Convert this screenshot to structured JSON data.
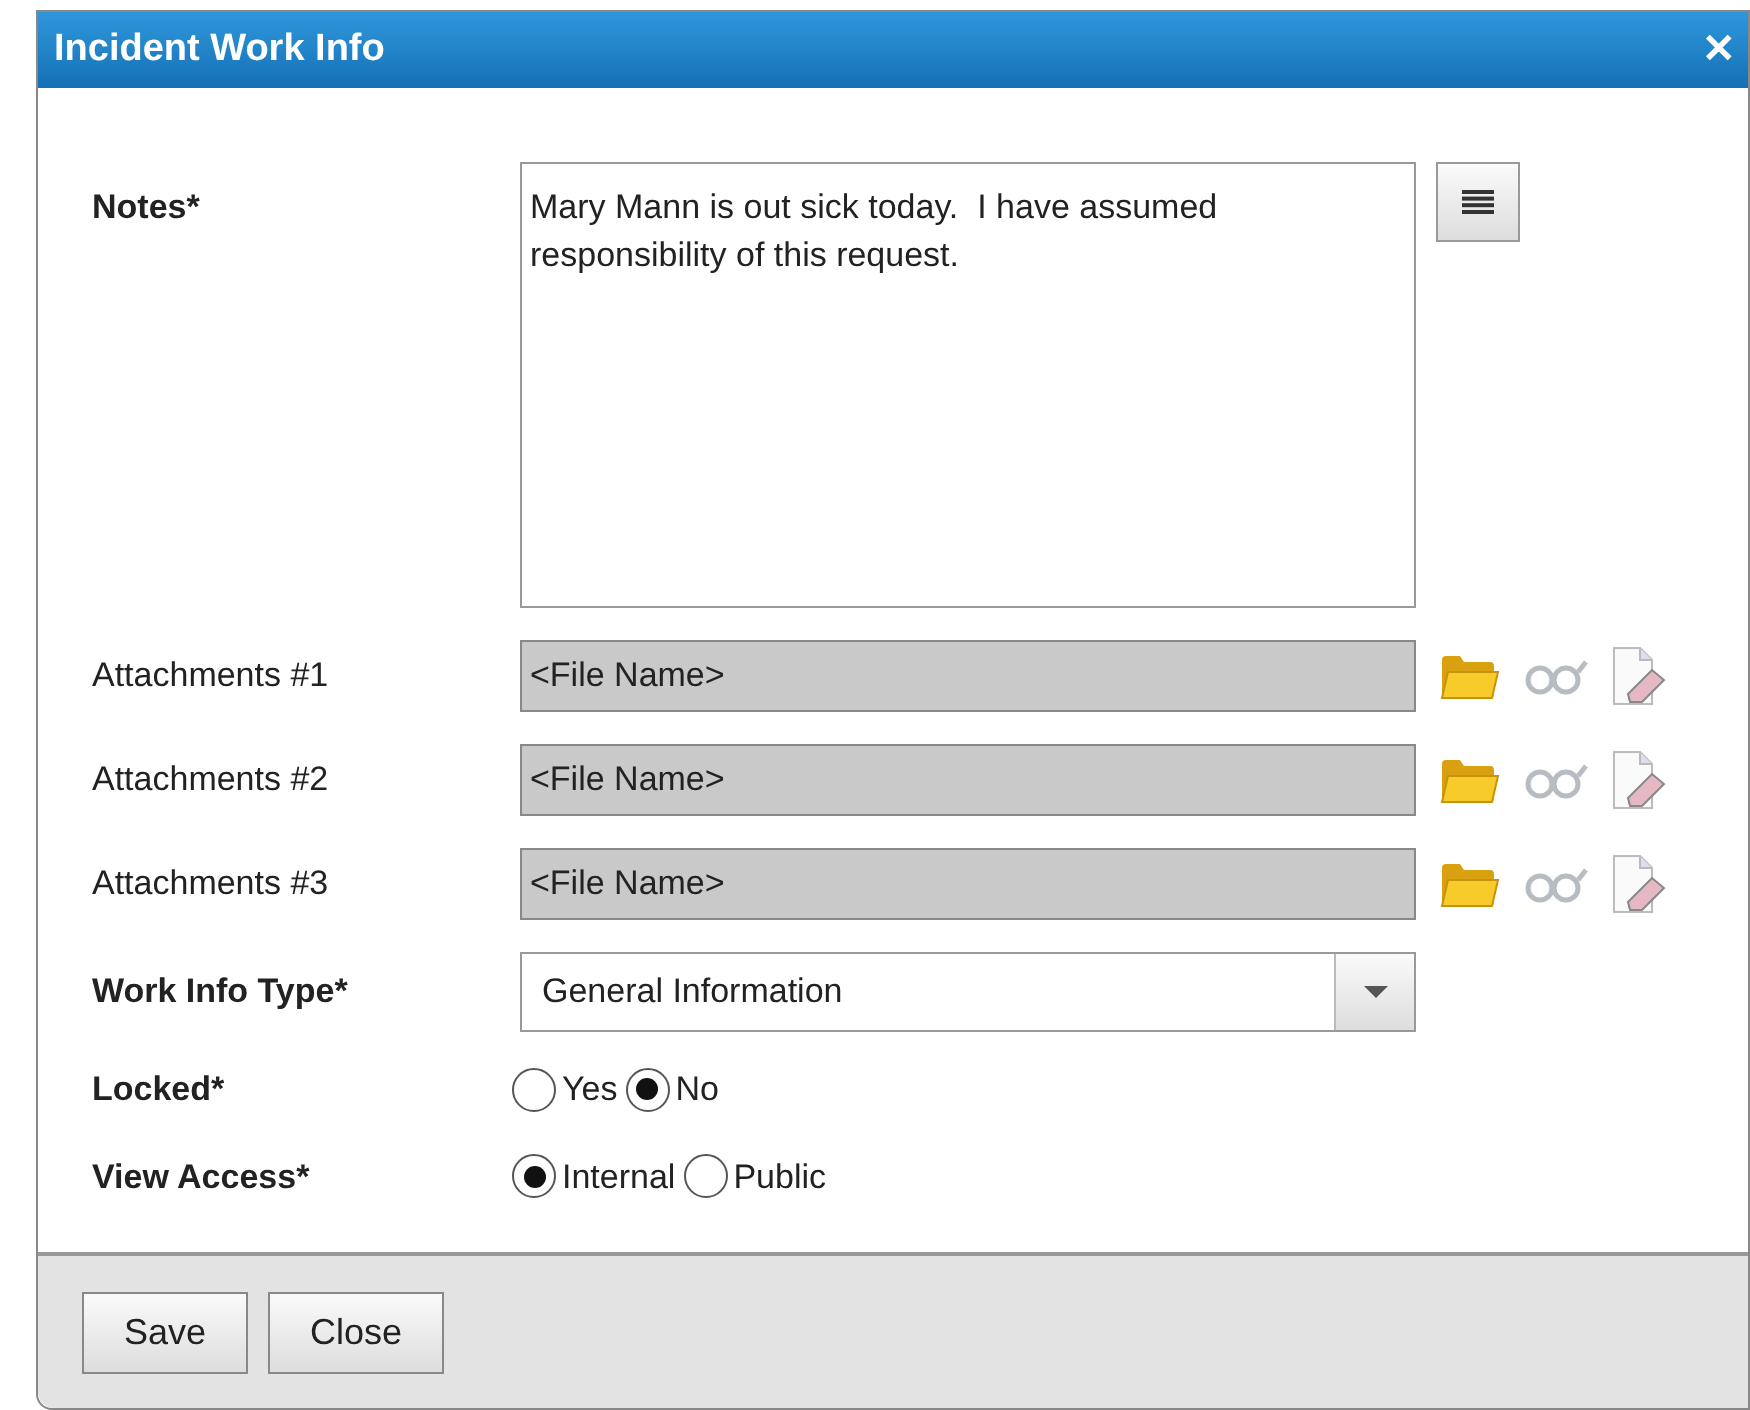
{
  "window": {
    "title": "Incident Work Info",
    "close": "✕"
  },
  "notes": {
    "label": "Notes*",
    "value": "Mary Mann is out sick today.  I have assumed responsibility of this request."
  },
  "attachments": [
    {
      "label": "Attachments #1",
      "value": "<File Name>"
    },
    {
      "label": "Attachments #2",
      "value": "<File Name>"
    },
    {
      "label": "Attachments #3",
      "value": "<File Name>"
    }
  ],
  "work_info_type": {
    "label": "Work Info Type*",
    "value": "General Information"
  },
  "radio_groups": [
    {
      "label": "Locked*",
      "options": [
        {
          "label": "Yes",
          "selected": false
        },
        {
          "label": "No",
          "selected": true
        }
      ]
    },
    {
      "label": "View Access*",
      "options": [
        {
          "label": "Internal",
          "selected": true
        },
        {
          "label": "Public",
          "selected": false
        }
      ]
    }
  ],
  "buttons": [
    "Save",
    "Close"
  ]
}
